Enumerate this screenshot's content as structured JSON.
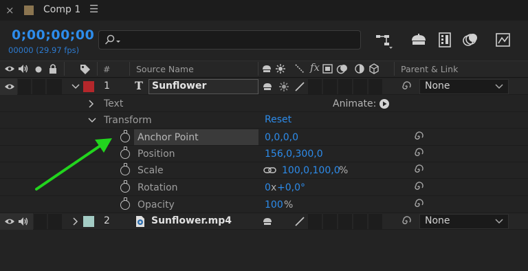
{
  "tab": {
    "close": "×",
    "title": "Comp 1",
    "menu": "☰",
    "swatch_color": "#8b7550"
  },
  "time": {
    "timecode": "0;00;00;00",
    "frames": "00000 (29.97 fps)"
  },
  "search": {
    "placeholder": "",
    "icon": "search-icon"
  },
  "columns": {
    "hash": "#",
    "source_name": "Source Name",
    "parent_link": "Parent & Link",
    "fx": "fx"
  },
  "layers": [
    {
      "number": "1",
      "name": "Sunflower",
      "type_glyph": "T",
      "label_color": "#b4272b",
      "parent": "None"
    },
    {
      "number": "2",
      "name": "Sunflower.mp4",
      "label_color": "#a3cbc4",
      "parent": "None"
    }
  ],
  "text_group": {
    "label": "Text",
    "animate_label": "Animate:"
  },
  "transform": {
    "label": "Transform",
    "reset": "Reset",
    "anchor_point": {
      "label": "Anchor Point",
      "value": "0,0,0,0"
    },
    "position": {
      "label": "Position",
      "value": "156,0,300,0"
    },
    "scale": {
      "label": "Scale",
      "value": "100,0,100,0",
      "unit": "%"
    },
    "rotation": {
      "label": "Rotation",
      "turns": "0",
      "x": "x",
      "degrees": "+0,0°"
    },
    "opacity": {
      "label": "Opacity",
      "value": "100",
      "unit": "%"
    }
  },
  "annotation": {
    "arrow_color": "#22d41e"
  }
}
